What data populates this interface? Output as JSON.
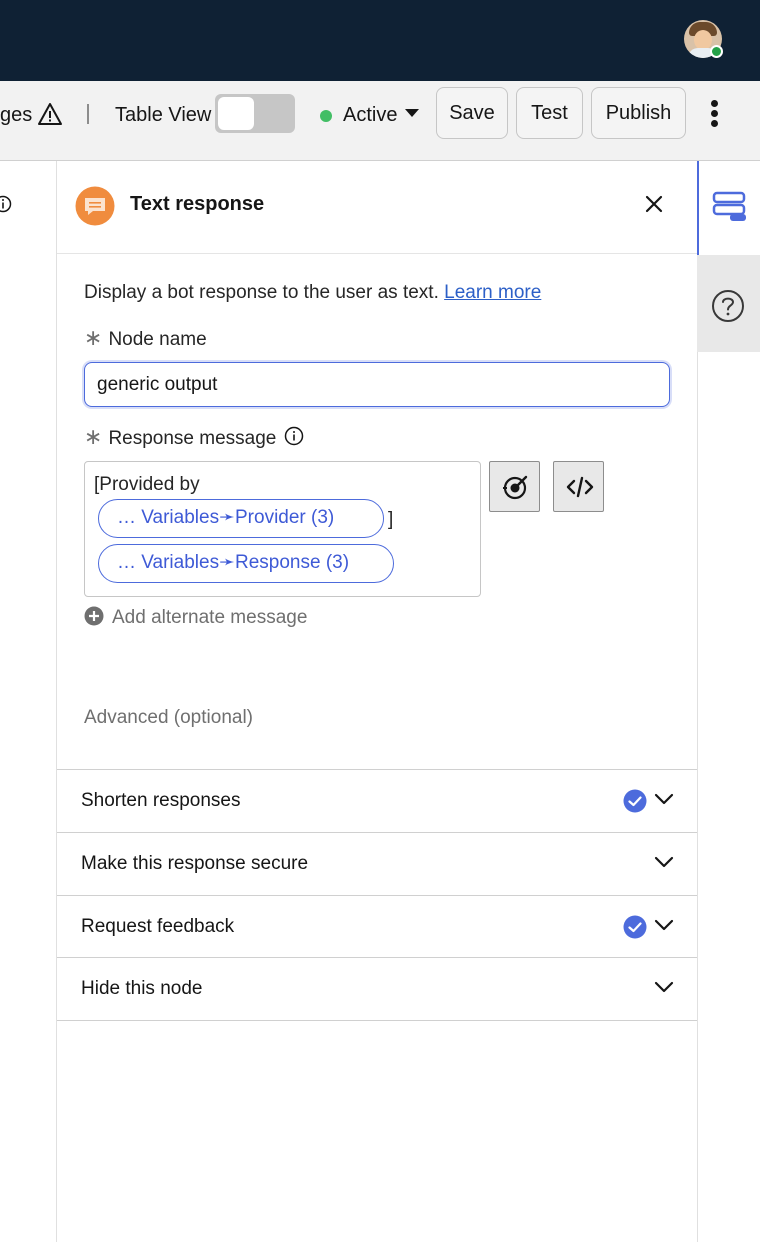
{
  "header": {
    "avatar_icon": "user-avatar",
    "status_color": "#24a148"
  },
  "toolbar": {
    "warnings_label": "ges",
    "table_view_label": "Table View",
    "table_view_enabled": false,
    "status_label": "Active",
    "status_color": "#42be65",
    "save_label": "Save",
    "test_label": "Test",
    "publish_label": "Publish",
    "more_icon": "overflow-menu-vertical-icon"
  },
  "panel": {
    "title": "Text response",
    "icon": "chat-bubble-icon",
    "icon_color": "#f08c3e",
    "description": "Display a bot response to the user as text.",
    "learn_more": "Learn more",
    "node_name_label": "Node name",
    "node_name_value": "generic output",
    "response_message_label": "Response message",
    "message": {
      "prefix": "[Provided by",
      "chip1": "… Variables➛Provider (3)",
      "bracket": "]",
      "chip2": "… Variables➛Response (3)"
    },
    "add_alternate": "Add alternate message",
    "advanced_label": "Advanced (optional)",
    "accordion": [
      {
        "label": "Shorten responses",
        "checked": true
      },
      {
        "label": "Make this response secure",
        "checked": false
      },
      {
        "label": "Request feedback",
        "checked": true
      },
      {
        "label": "Hide this node",
        "checked": false
      }
    ],
    "accent_color": "#4d6bdc"
  },
  "rail": {
    "items": [
      {
        "icon": "node-list-icon",
        "active": true
      },
      {
        "icon": "help-icon",
        "active": false
      }
    ]
  }
}
